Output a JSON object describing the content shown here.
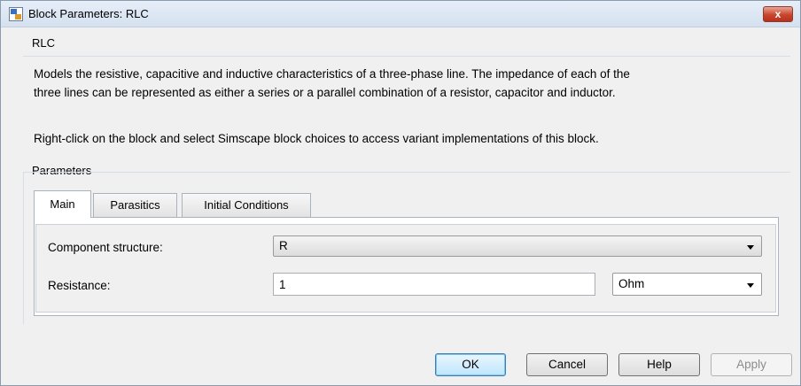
{
  "window": {
    "title": "Block Parameters: RLC",
    "close_glyph": "x"
  },
  "description": {
    "group_label": "RLC",
    "paragraph_1_line_1": "Models the resistive, capacitive and inductive characteristics of a three-phase line. The impedance of each of the",
    "paragraph_1_line_2": "three lines can be represented as either a series or a parallel combination of a resistor, capacitor and inductor.",
    "paragraph_2": "Right-click on the block and select Simscape block choices to access variant implementations of this block."
  },
  "parameters": {
    "group_label": "Parameters",
    "tabs": [
      {
        "label": "Main",
        "active": true
      },
      {
        "label": "Parasitics",
        "active": false
      },
      {
        "label": "Initial Conditions",
        "active": false
      }
    ],
    "component_structure": {
      "label": "Component structure:",
      "value": "R"
    },
    "resistance": {
      "label": "Resistance:",
      "value": "1",
      "unit": "Ohm"
    }
  },
  "buttons": {
    "ok": "OK",
    "cancel": "Cancel",
    "help": "Help",
    "apply": "Apply"
  },
  "icons": {
    "app": "simulink-block-icon",
    "close": "close-icon",
    "dropdown": "chevron-down-icon"
  },
  "colors": {
    "close_button": "#c7452d",
    "default_button_border": "#3c7fb1",
    "window_background": "#f0f0f0"
  }
}
